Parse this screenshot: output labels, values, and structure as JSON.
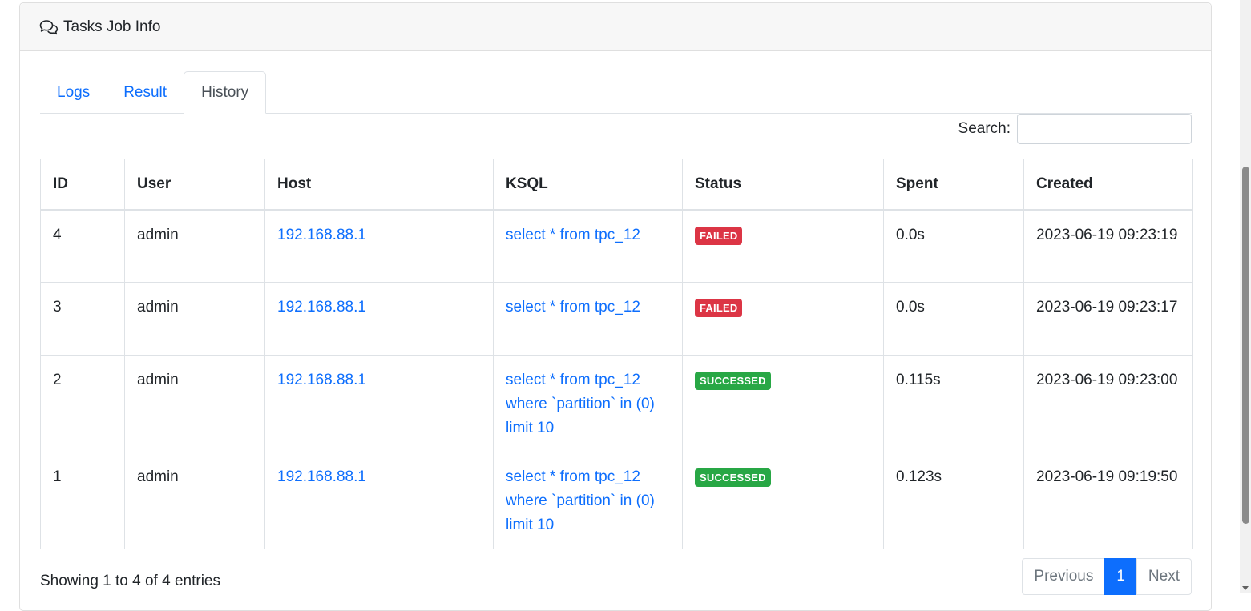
{
  "header": {
    "title": "Tasks Job Info",
    "icon": "comments-icon"
  },
  "tabs": [
    {
      "label": "Logs",
      "active": false
    },
    {
      "label": "Result",
      "active": false
    },
    {
      "label": "History",
      "active": true
    }
  ],
  "search": {
    "label": "Search:",
    "value": ""
  },
  "table": {
    "columns": [
      "ID",
      "User",
      "Host",
      "KSQL",
      "Status",
      "Spent",
      "Created"
    ],
    "rows": [
      {
        "id": "4",
        "user": "admin",
        "host": "192.168.88.1",
        "ksql": "select * from tpc_12",
        "status": "FAILED",
        "spent": "0.0s",
        "created": "2023-06-19 09:23:19"
      },
      {
        "id": "3",
        "user": "admin",
        "host": "192.168.88.1",
        "ksql": "select * from tpc_12",
        "status": "FAILED",
        "spent": "0.0s",
        "created": "2023-06-19 09:23:17"
      },
      {
        "id": "2",
        "user": "admin",
        "host": "192.168.88.1",
        "ksql": "select * from tpc_12 where `partition` in (0) limit 10",
        "status": "SUCCESSED",
        "spent": "0.115s",
        "created": "2023-06-19 09:23:00"
      },
      {
        "id": "1",
        "user": "admin",
        "host": "192.168.88.1",
        "ksql": "select * from tpc_12 where `partition` in (0) limit 10",
        "status": "SUCCESSED",
        "spent": "0.123s",
        "created": "2023-06-19 09:19:50"
      }
    ]
  },
  "footer": {
    "info": "Showing 1 to 4 of 4 entries",
    "pager": {
      "previous": "Previous",
      "current": "1",
      "next": "Next"
    }
  },
  "colors": {
    "link": "#0d6efd",
    "failed": "#dc3545",
    "success": "#28a745"
  }
}
